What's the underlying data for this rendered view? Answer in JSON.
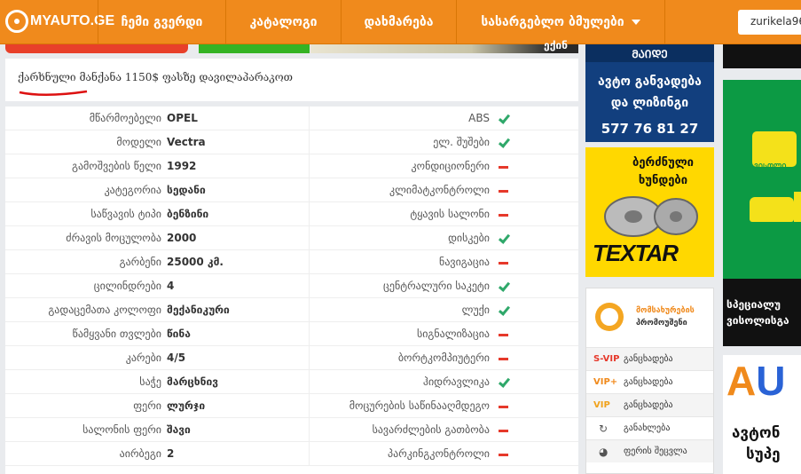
{
  "nav": {
    "logo": "MYAUTO.GE",
    "items": [
      "ჩემი გვერდი",
      "კატალოგი",
      "დახმარება",
      "სასარგებლო ბმულები"
    ],
    "user": "zurikela96"
  },
  "banner_strip": {
    "money_text": "ექინ"
  },
  "description": "ქარხნული მანქანა 1150$ ფასზე დავილაპარაკოთ",
  "specs": [
    {
      "label": "მწარმოებელი",
      "value": "OPEL",
      "feature": "ABS",
      "has": true
    },
    {
      "label": "მოდელი",
      "value": "Vectra",
      "feature": "ელ. შუშები",
      "has": true
    },
    {
      "label": "გამოშვების წელი",
      "value": "1992",
      "feature": "კონდიციონერი",
      "has": false
    },
    {
      "label": "კატეგორია",
      "value": "სედანი",
      "feature": "კლიმატკონტროლი",
      "has": false
    },
    {
      "label": "საწვავის ტიპი",
      "value": "ბენზინი",
      "feature": "ტყავის სალონი",
      "has": false
    },
    {
      "label": "ძრავის მოცულობა",
      "value": "2000",
      "feature": "დისკები",
      "has": true
    },
    {
      "label": "გარბენი",
      "value": "25000 კმ.",
      "feature": "ნავიგაცია",
      "has": false
    },
    {
      "label": "ცილინდრები",
      "value": "4",
      "feature": "ცენტრალური საკეტი",
      "has": true
    },
    {
      "label": "გადაცემათა კოლოფი",
      "value": "მექანიკური",
      "feature": "ლუქი",
      "has": true
    },
    {
      "label": "წამყვანი თვლები",
      "value": "წინა",
      "feature": "სიგნალიზაცია",
      "has": false
    },
    {
      "label": "კარები",
      "value": "4/5",
      "feature": "ბორტკომპიუტერი",
      "has": false
    },
    {
      "label": "საჭე",
      "value": "მარცხნივ",
      "feature": "ჰიდრავლიკა",
      "has": true
    },
    {
      "label": "ფერი",
      "value": "ლურჯი",
      "feature": "მოცურების საწინააღმდეგო",
      "has": false
    },
    {
      "label": "სალონის ფერი",
      "value": "შავი",
      "feature": "სავარძლების გათბობა",
      "has": false
    },
    {
      "label": "აირბეგი",
      "value": "2",
      "feature": "პარკინგკონტროლი",
      "has": false
    }
  ],
  "ads": {
    "auto_top": "ᲛᲐᲘᲓᲔ",
    "auto_l1": "ავტო განვადება",
    "auto_l2": "და ლიზინგი",
    "auto_phone": "577 76 81 27",
    "textar_l1": "ბერძნული",
    "textar_l2": "ხუნდები",
    "textar_brand": "TEXTAR",
    "promo_t1": "მომსახურების",
    "promo_t2": "პრომოუშენი",
    "promo_rows": [
      {
        "tag": "S-VIP",
        "text": "განცხადება",
        "color": "#e6392b",
        "icon": ""
      },
      {
        "tag": "VIP+",
        "text": "განცხადება",
        "color": "#f08a1c",
        "icon": ""
      },
      {
        "tag": "VIP",
        "text": "განცხადება",
        "color": "#f0a21c",
        "icon": ""
      },
      {
        "tag": "",
        "text": "განახლება",
        "color": "#555555",
        "icon": "↻"
      },
      {
        "tag": "",
        "text": "ფერის შეცვლა",
        "color": "#555555",
        "icon": "◕"
      }
    ],
    "right_green_badge": "ᲕᲘᲡᲝᲚᲘ",
    "right_black_l1": "სპეციალუ",
    "right_black_l2": "ვისოლისგა",
    "right_au_l1": "ავტონ",
    "right_au_l2": "სუპე"
  }
}
